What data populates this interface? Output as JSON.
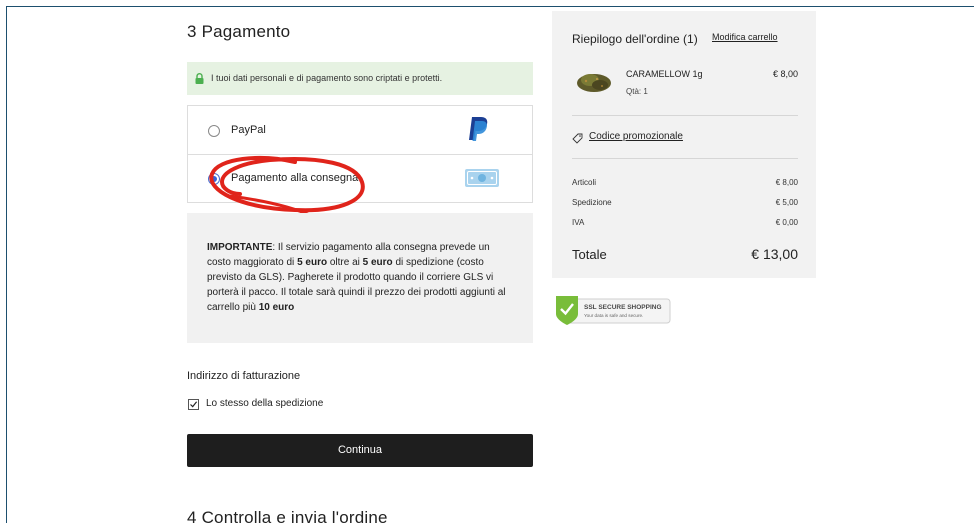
{
  "checkout": {
    "step3_title": "3  Pagamento",
    "secure_note": "I tuoi dati personali e di pagamento sono criptati e protetti.",
    "payment_options": [
      {
        "label": "PayPal",
        "selected": false,
        "icon": "paypal-icon"
      },
      {
        "label": "Pagamento alla consegna",
        "selected": true,
        "icon": "cash-icon"
      }
    ],
    "important": {
      "bold_title": "IMPORTANTE",
      "text1": ": Il servizio pagamento alla consegna prevede un costo maggiorato di ",
      "amount1": "5 euro",
      "text2": " oltre ai ",
      "amount2": "5 euro",
      "text3": " di spedizione (costo previsto da GLS). Pagherete il prodotto quando il corriere GLS vi porterà il pacco. Il totale sarà quindi il prezzo dei prodotti aggiunti al carrello più ",
      "amount3": "10 euro"
    },
    "billing_label": "Indirizzo di fatturazione",
    "same_as_shipping_label": "Lo stesso della spedizione",
    "same_as_shipping_checked": true,
    "continue_label": "Continua",
    "step4_title": "4  Controlla e invia l'ordine"
  },
  "summary": {
    "title": "Riepilogo dell'ordine (1)",
    "edit_cart": "Modifica carrello",
    "product": {
      "name": "CARAMELLOW 1g",
      "qty": "Qtà: 1",
      "price": "€ 8,00"
    },
    "promo_label": "Codice promozionale",
    "lines": [
      {
        "label": "Articoli",
        "value": "€ 8,00"
      },
      {
        "label": "Spedizione",
        "value": "€ 5,00"
      },
      {
        "label": "IVA",
        "value": "€ 0,00"
      }
    ],
    "total_label": "Totale",
    "total_value": "€ 13,00"
  },
  "badge": {
    "line1": "SSL SECURE SHOPPING",
    "line2": "Your data is safe and secure."
  },
  "colors": {
    "accent_green": "#4caf50",
    "button_dark": "#1e1e1e",
    "annotation_red": "#e0241b",
    "radio_blue": "#3a63d6"
  }
}
